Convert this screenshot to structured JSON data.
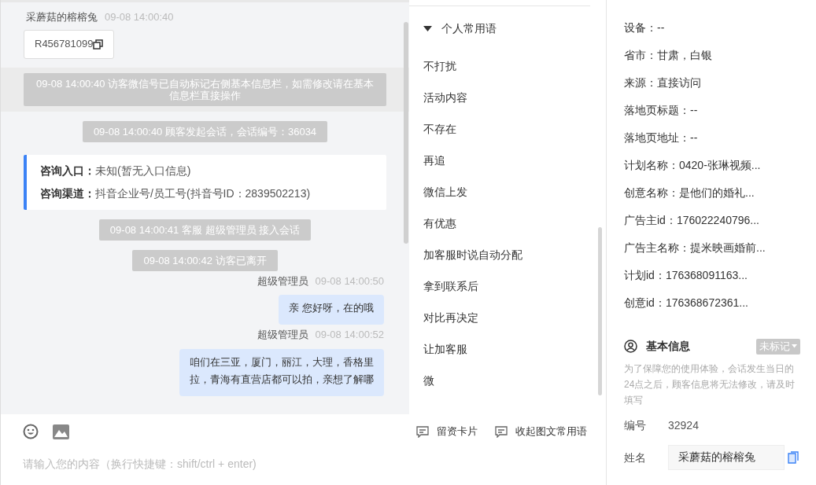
{
  "chat": {
    "messages": [
      {
        "kind": "visitor_sender",
        "name": "采蘑菇的榕榕兔",
        "time": "09-08 14:00:40"
      },
      {
        "kind": "code_card",
        "text": "R456781099"
      },
      {
        "kind": "notice",
        "text": "09-08 14:00:40 访客微信号已自动标记右侧基本信息栏，如需修改请在基本信息栏直接操作",
        "highlighted": true
      },
      {
        "kind": "notice",
        "text": "09-08 14:00:40 顾客发起会话，会话编号：36034",
        "highlighted": false
      },
      {
        "kind": "info_card",
        "rows": [
          {
            "label": "咨询入口：",
            "value": "未知(暂无入口信息)"
          },
          {
            "label": "咨询渠道：",
            "value": "抖音企业号/员工号(抖音号ID：2839502213)"
          }
        ]
      },
      {
        "kind": "notice",
        "text": "09-08 14:00:41 客服 超级管理员 接入会话",
        "highlighted": false
      },
      {
        "kind": "notice",
        "text": "09-08 14:00:42 访客已离开",
        "highlighted": false
      },
      {
        "kind": "agent_sender",
        "name": "超级管理员",
        "time": "09-08 14:00:50"
      },
      {
        "kind": "bubble",
        "lines": [
          "亲 您好呀，在的哦"
        ]
      },
      {
        "kind": "agent_sender",
        "name": "超级管理员",
        "time": "09-08 14:00:52"
      },
      {
        "kind": "bubble",
        "lines": [
          "咱们在三亚，厦门，丽江，大理，香格里",
          "拉，青海有直营店都可以拍，亲想了解哪"
        ]
      }
    ]
  },
  "phrases": {
    "title": "个人常用语",
    "expanded": true,
    "items": [
      "不打扰",
      "活动内容",
      "不存在",
      "再追",
      "微信上发",
      "有优惠",
      "加客服时说自动分配",
      "拿到联系后",
      "对比再决定",
      "让加客服",
      "微"
    ]
  },
  "composer": {
    "actions": [
      "留资卡片",
      "收起图文常用语"
    ],
    "placeholder": "请输入您的内容（换行快捷键：shift/ctrl + enter)"
  },
  "source_info": {
    "rows": [
      "设备：--",
      "省市：甘肃，白银",
      "来源：直接访问",
      "落地页标题：--",
      "落地页地址：--",
      "计划名称：0420-张琳视频...",
      "创意名称：是他们的婚礼...",
      "广告主id：176022240796...",
      "广告主名称：提米映画婚前...",
      "计划id：176368091163...",
      "创意id：176368672361..."
    ]
  },
  "basic_info": {
    "title": "基本信息",
    "tag": "未标记",
    "note": "为了保障您的使用体验，会话发生当日的24点之后，顾客信息将无法修改，请及时填写",
    "fields": [
      {
        "kind": "text",
        "label": "编号",
        "value": "32924"
      },
      {
        "kind": "input",
        "label": "姓名",
        "value": "采蘑菇的榕榕兔"
      }
    ]
  }
}
